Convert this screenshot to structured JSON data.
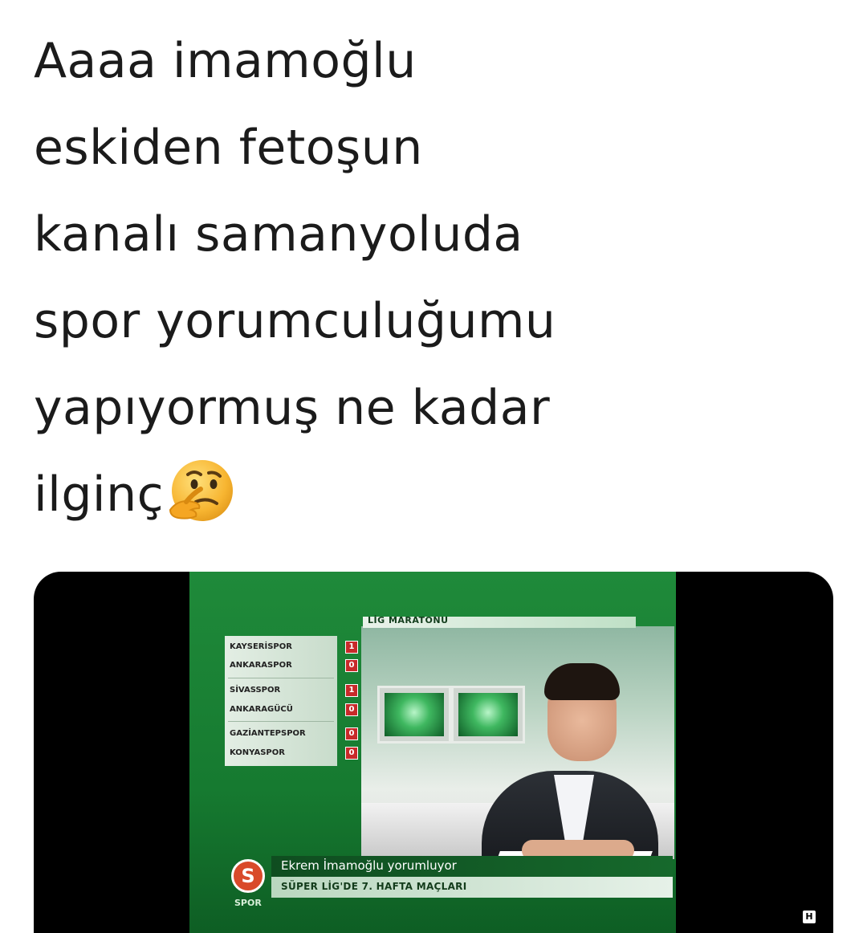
{
  "caption": {
    "lines": [
      "Aaaa imamoğlu",
      "eskiden fetoşun",
      "kanalı samanyoluda",
      "spor yorumculuğumu",
      "yapıyormuş ne kadar",
      "ilginç"
    ],
    "emoji": "thinking-face"
  },
  "tv": {
    "program": "LİG MARATONU",
    "results": [
      {
        "team": "KAYSERİSPOR",
        "score": "1"
      },
      {
        "team": "ANKARASPOR",
        "score": "0"
      },
      {
        "team": "SİVASSPOR",
        "score": "1"
      },
      {
        "team": "ANKARAGÜCÜ",
        "score": "0"
      },
      {
        "team": "GAZİANTEPSPOR",
        "score": "0"
      },
      {
        "team": "KONYASPOR",
        "score": "0"
      }
    ],
    "lower_third": {
      "name": "Ekrem İmamoğlu yorumluyor",
      "subtitle": "SÜPER LİG'DE 7. HAFTA MAÇLARI"
    },
    "channel_logo_letter": "S",
    "channel_logo_text": "SPOR",
    "corner_badge": "H"
  }
}
